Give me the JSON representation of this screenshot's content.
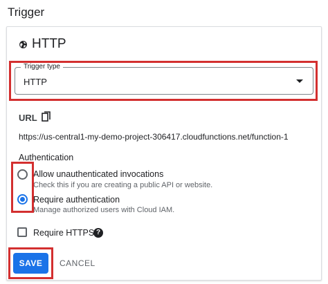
{
  "section_title": "Trigger",
  "card": {
    "title": "HTTP",
    "title_icon": "globe-icon"
  },
  "trigger_type": {
    "legend": "Trigger type",
    "value": "HTTP"
  },
  "url": {
    "label": "URL",
    "value": "https://us-central1-my-demo-project-306417.cloudfunctions.net/function-1",
    "copy_icon": "copy-icon"
  },
  "authentication": {
    "label": "Authentication",
    "options": [
      {
        "label": "Allow unauthenticated invocations",
        "description": "Check this if you are creating a public API or website.",
        "selected": false
      },
      {
        "label": "Require authentication",
        "description": "Manage authorized users with Cloud IAM.",
        "selected": true
      }
    ]
  },
  "require_https": {
    "label": "Require HTTPS",
    "checked": false,
    "help_icon": "help-icon"
  },
  "actions": {
    "save": "SAVE",
    "cancel": "CANCEL"
  },
  "colors": {
    "primary": "#1a73e8",
    "highlight": "#d32f2f",
    "text": "#202124",
    "muted": "#5f6368"
  }
}
